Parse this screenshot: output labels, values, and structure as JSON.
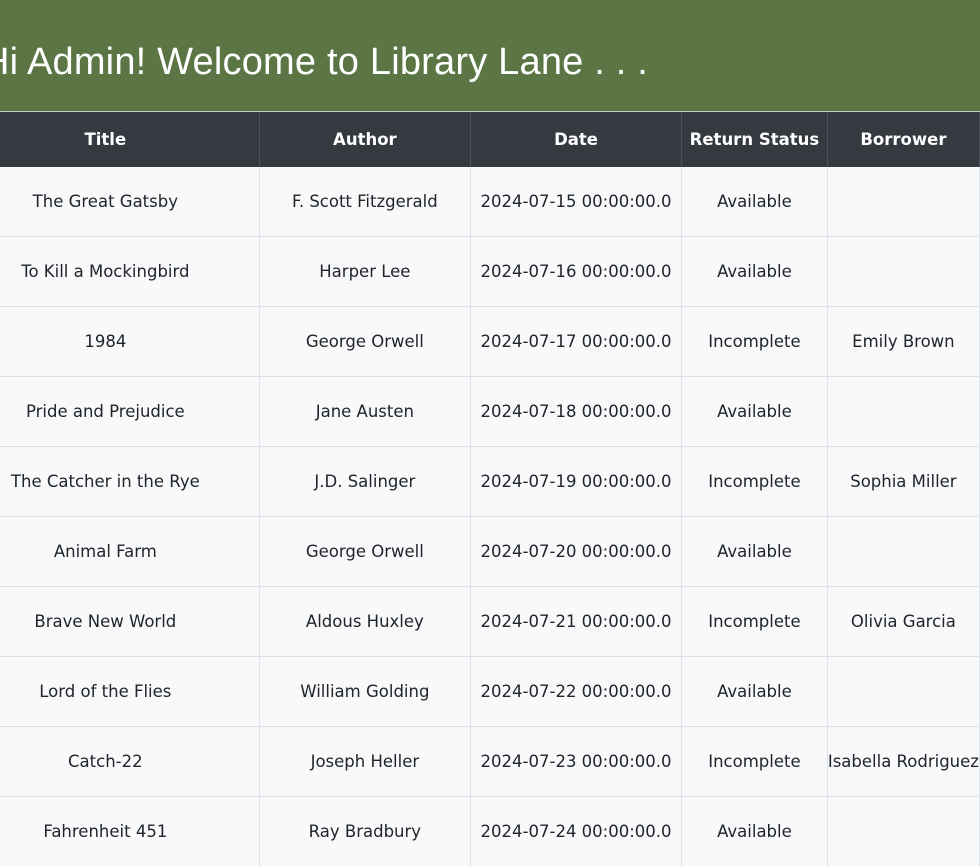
{
  "banner": {
    "title": "Hi Admin! Welcome to Library Lane . . ."
  },
  "table": {
    "headers": {
      "title": "Title",
      "author": "Author",
      "date": "Date",
      "status": "Return Status",
      "borrower": "Borrower"
    },
    "rows": [
      {
        "title": "The Great Gatsby",
        "author": "F. Scott Fitzgerald",
        "date": "2024-07-15 00:00:00.0",
        "status": "Available",
        "borrower": ""
      },
      {
        "title": "To Kill a Mockingbird",
        "author": "Harper Lee",
        "date": "2024-07-16 00:00:00.0",
        "status": "Available",
        "borrower": ""
      },
      {
        "title": "1984",
        "author": "George Orwell",
        "date": "2024-07-17 00:00:00.0",
        "status": "Incomplete",
        "borrower": "Emily Brown"
      },
      {
        "title": "Pride and Prejudice",
        "author": "Jane Austen",
        "date": "2024-07-18 00:00:00.0",
        "status": "Available",
        "borrower": ""
      },
      {
        "title": "The Catcher in the Rye",
        "author": "J.D. Salinger",
        "date": "2024-07-19 00:00:00.0",
        "status": "Incomplete",
        "borrower": "Sophia Miller"
      },
      {
        "title": "Animal Farm",
        "author": "George Orwell",
        "date": "2024-07-20 00:00:00.0",
        "status": "Available",
        "borrower": ""
      },
      {
        "title": "Brave New World",
        "author": "Aldous Huxley",
        "date": "2024-07-21 00:00:00.0",
        "status": "Incomplete",
        "borrower": "Olivia Garcia"
      },
      {
        "title": "Lord of the Flies",
        "author": "William Golding",
        "date": "2024-07-22 00:00:00.0",
        "status": "Available",
        "borrower": ""
      },
      {
        "title": "Catch-22",
        "author": "Joseph Heller",
        "date": "2024-07-23 00:00:00.0",
        "status": "Incomplete",
        "borrower": "Isabella Rodriguez"
      },
      {
        "title": "Fahrenheit 451",
        "author": "Ray Bradbury",
        "date": "2024-07-24 00:00:00.0",
        "status": "Available",
        "borrower": ""
      }
    ]
  }
}
